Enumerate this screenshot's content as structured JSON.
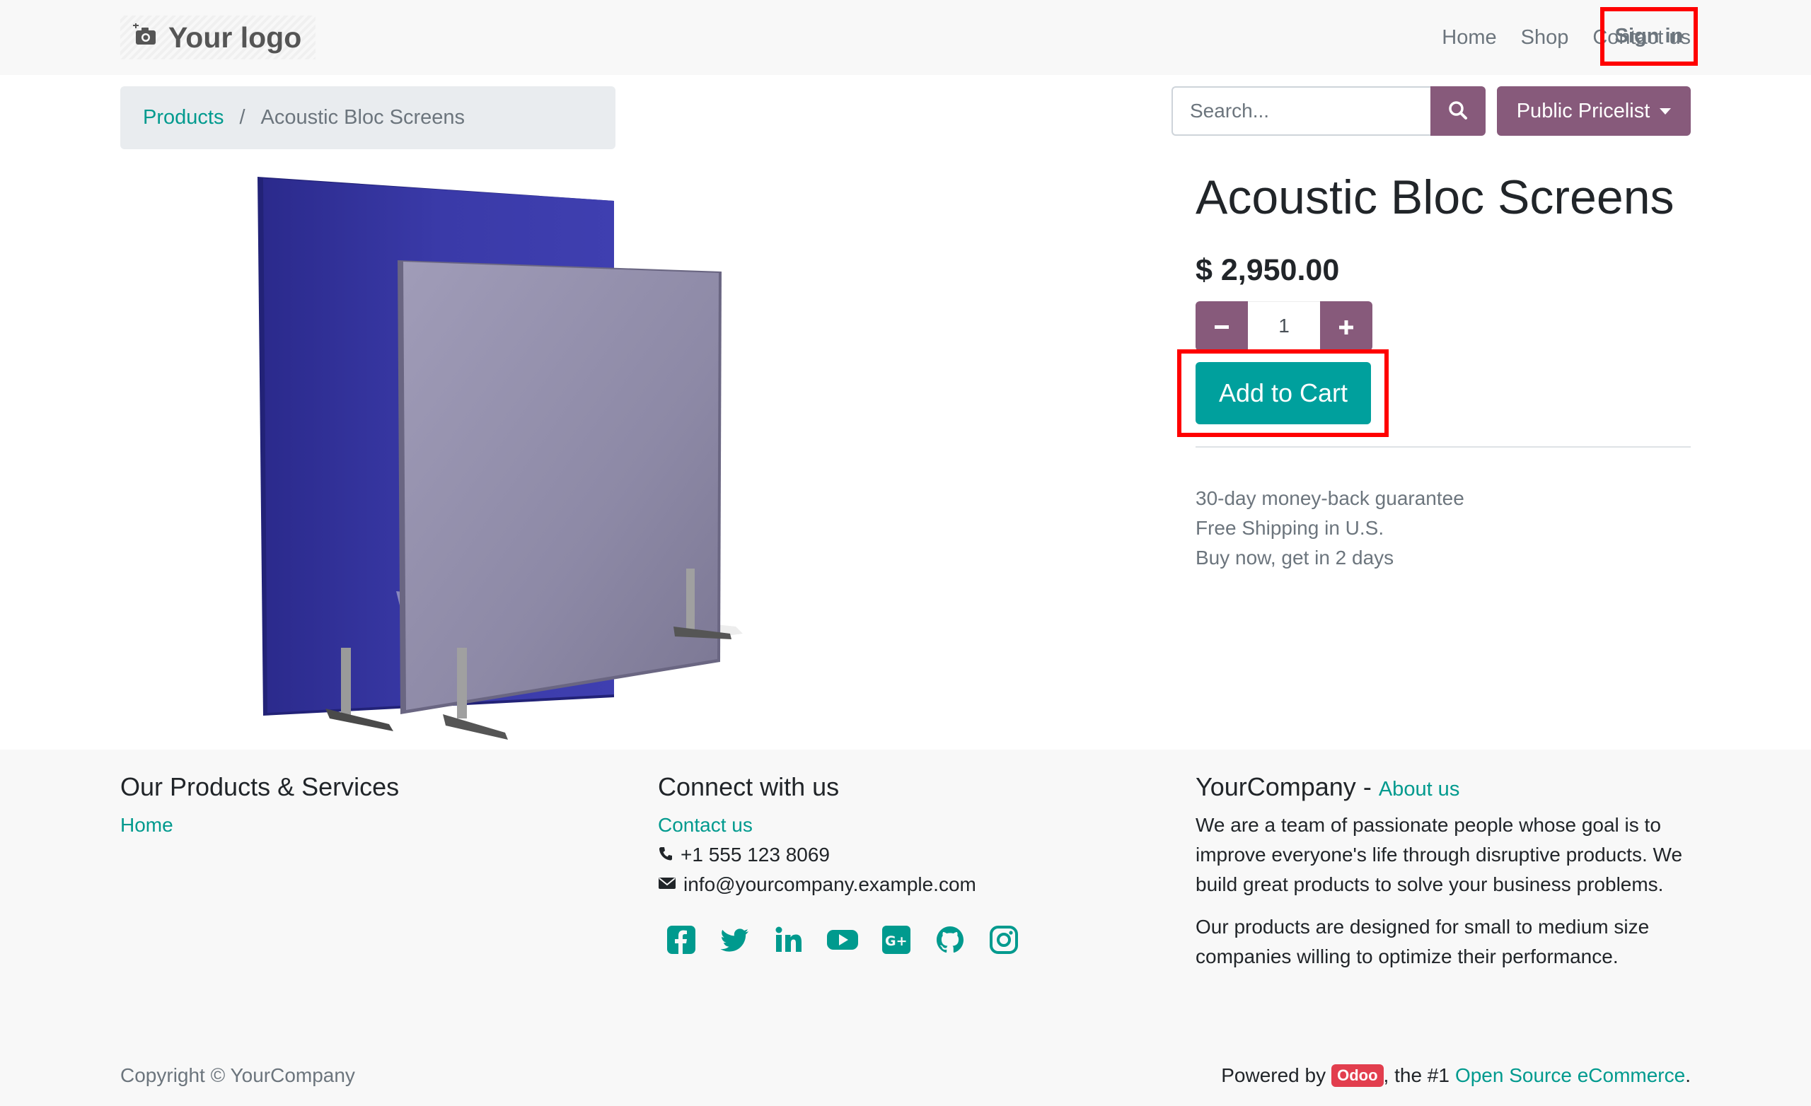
{
  "header": {
    "logo_text": "Your logo",
    "nav": [
      "Home",
      "Shop",
      "Contact us"
    ],
    "signin_label": "Sign in"
  },
  "breadcrumb": {
    "parent": "Products",
    "separator": "/",
    "current": "Acoustic Bloc Screens"
  },
  "search": {
    "placeholder": "Search..."
  },
  "pricelist": {
    "label": "Public Pricelist"
  },
  "product": {
    "title": "Acoustic Bloc Screens",
    "price": "$ 2,950.00",
    "quantity": "1",
    "add_to_cart_label": "Add to Cart",
    "perks": [
      "30-day money-back guarantee",
      "Free Shipping in U.S.",
      "Buy now, get in 2 days"
    ]
  },
  "footer": {
    "col1": {
      "title": "Our Products & Services",
      "links": [
        "Home"
      ]
    },
    "col2": {
      "title": "Connect with us",
      "contact_link": "Contact us",
      "phone": "+1 555 123 8069",
      "email": "info@yourcompany.example.com",
      "socials": [
        "facebook-icon",
        "twitter-icon",
        "linkedin-icon",
        "youtube-icon",
        "google-plus-icon",
        "github-icon",
        "instagram-icon"
      ]
    },
    "col3": {
      "company": "YourCompany",
      "dash": "-",
      "about_link": "About us",
      "para1": "We are a team of passionate people whose goal is to improve everyone's life through disruptive products. We build great products to solve your business problems.",
      "para2": "Our products are designed for small to medium size companies willing to optimize their performance."
    },
    "copyright": "Copyright © YourCompany",
    "powered_prefix": "Powered by",
    "odoo_badge": "Odoo",
    "powered_middle": ", the #1",
    "powered_link": "Open Source eCommerce",
    "powered_suffix": "."
  },
  "colors": {
    "accent_teal": "#009a8e",
    "button_purple": "#875a7b",
    "cart_teal": "#00a09d",
    "highlight_red": "#ff0000"
  }
}
